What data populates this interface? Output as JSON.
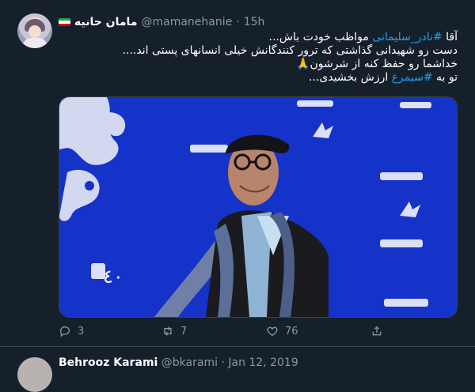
{
  "tweet": {
    "display_name": "مامان حانیه",
    "handle": "@mamanehanie",
    "dot": "·",
    "time": "15h",
    "text": {
      "line1_pre": "آقا ",
      "line1_tag": "#نادر_سلیمانی",
      "line1_post": "  مواظب خودت باش...",
      "line2": "دست رو شهیدانی گذاشتی که ترور کنندگانش  خیلی انسانهای پستی اند....",
      "line3": "خداشما رو حفظ کنه از شرشون🙏",
      "line4_pre": "تو به ",
      "line4_tag": "#سیمرغ",
      "line4_post": " ارزش  بخشیدی..."
    },
    "actions": {
      "reply_count": "3",
      "retweet_count": "7",
      "like_count": "76"
    },
    "image": {
      "backdrop_color": "#1532c9",
      "backdrop_text": "٤٠"
    }
  },
  "next_tweet": {
    "display_name": "Behrooz Karami",
    "handle": "@bkarami",
    "dot": "·",
    "time": "Jan 12, 2019"
  },
  "colors": {
    "background": "#15202b",
    "text_secondary": "#8899a6",
    "link": "#1da1f2",
    "border": "#38444d"
  }
}
